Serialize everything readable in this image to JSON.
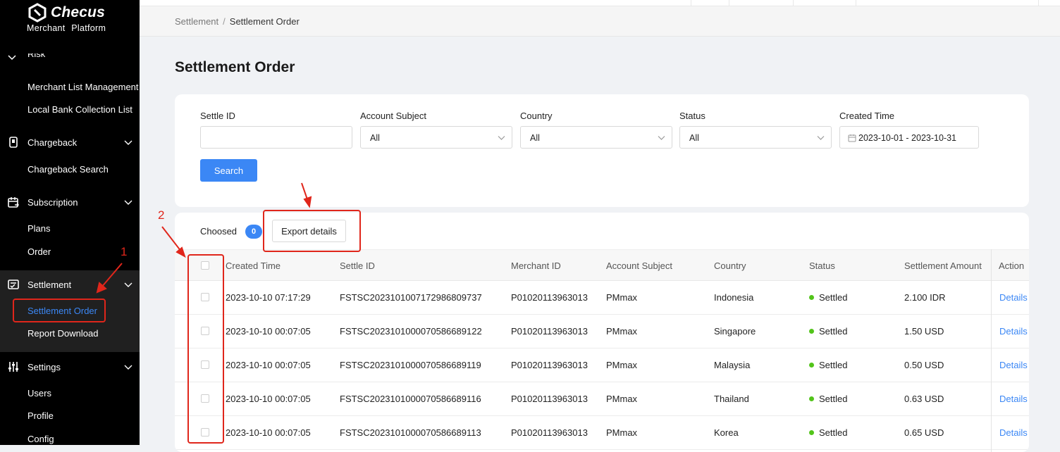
{
  "app": {
    "brand": "Checus",
    "subtitle": "Merchant Platform"
  },
  "sidebar": {
    "partial_group": "Risk",
    "risk_items": [
      "Merchant List Management",
      "Local Bank Collection List"
    ],
    "groups": [
      {
        "label": "Chargeback",
        "icon": "chargeback-icon",
        "items": [
          "Chargeback Search"
        ]
      },
      {
        "label": "Subscription",
        "icon": "calendar-icon",
        "items": [
          "Plans",
          "Order"
        ]
      },
      {
        "label": "Settlement",
        "icon": "settlement-icon",
        "items": [
          "Settlement Order",
          "Report Download"
        ],
        "active_item": "Settlement Order"
      },
      {
        "label": "Settings",
        "icon": "sliders-icon",
        "items": [
          "Users",
          "Profile",
          "Config"
        ]
      }
    ]
  },
  "breadcrumb": {
    "parent": "Settlement",
    "separator": "/",
    "current": "Settlement Order"
  },
  "page_title": "Settlement Order",
  "filters": {
    "settle_id": {
      "label": "Settle ID",
      "value": ""
    },
    "account_subject": {
      "label": "Account Subject",
      "value": "All"
    },
    "country": {
      "label": "Country",
      "value": "All"
    },
    "status": {
      "label": "Status",
      "value": "All"
    },
    "created_time": {
      "label": "Created Time",
      "value": "2023-10-01 - 2023-10-31"
    },
    "search_label": "Search"
  },
  "table_toolbar": {
    "choosed_label": "Choosed",
    "choosed_count": "0",
    "export_label": "Export details"
  },
  "table": {
    "columns": [
      "Created Time",
      "Settle ID",
      "Merchant ID",
      "Account Subject",
      "Country",
      "Status",
      "Settlement Amount",
      "Action"
    ],
    "rows": [
      {
        "created": "2023-10-10 07:17:29",
        "settle_id": "FSTSC202310100717298680 9737",
        "merchant_id": "P01020113963013",
        "subject": "PMmax",
        "country": "Indonesia",
        "status": "Settled",
        "amount": "2.100 IDR",
        "action": "Details"
      },
      {
        "created": "2023-10-10 00:07:05",
        "settle_id": "FSTSC20231010000705866891 22",
        "merchant_id": "P01020113963013",
        "subject": "PMmax",
        "country": "Singapore",
        "status": "Settled",
        "amount": "1.50 USD",
        "action": "Details"
      },
      {
        "created": "2023-10-10 00:07:05",
        "settle_id": "FSTSC20231010000705866891 19",
        "merchant_id": "P01020113963013",
        "subject": "PMmax",
        "country": "Malaysia",
        "status": "Settled",
        "amount": "0.50 USD",
        "action": "Details"
      },
      {
        "created": "2023-10-10 00:07:05",
        "settle_id": "FSTSC20231010000705866891 16",
        "merchant_id": "P01020113963013",
        "subject": "PMmax",
        "country": "Thailand",
        "status": "Settled",
        "amount": "0.63 USD",
        "action": "Details"
      },
      {
        "created": "2023-10-10 00:07:05",
        "settle_id": "FSTSC20231010000705866891 13",
        "merchant_id": "P01020113963013",
        "subject": "PMmax",
        "country": "Korea",
        "status": "Settled",
        "amount": "0.65 USD",
        "action": "Details"
      }
    ]
  },
  "annotations": {
    "marker_1": "1",
    "marker_2": "2",
    "color": "#e0261b"
  },
  "colors": {
    "accent": "#3b87f5",
    "sidebar_bg": "#000000",
    "status_settled": "#52c41a"
  }
}
